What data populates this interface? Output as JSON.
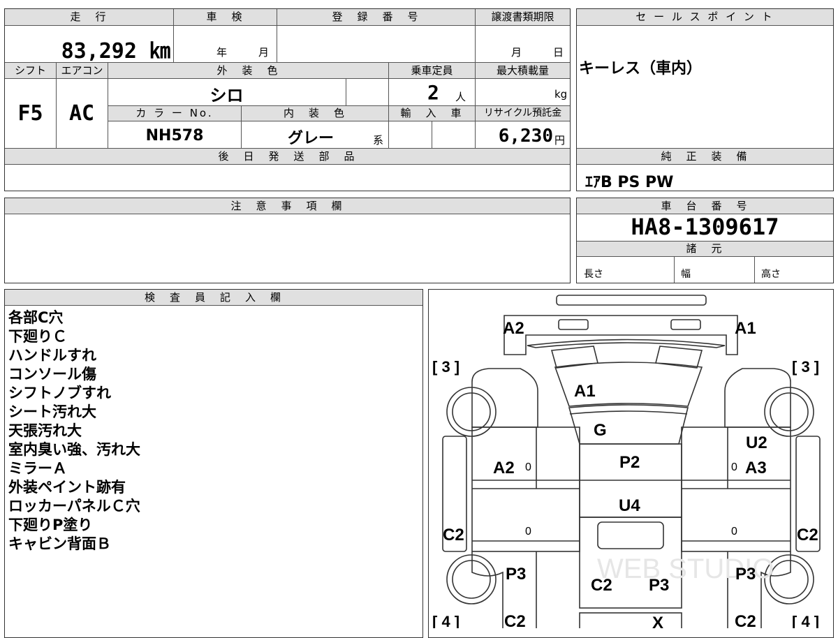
{
  "top_table": {
    "mileage_label": "走　行",
    "mileage_value": "83,292 ㎞",
    "inspection_label": "車　検",
    "inspection_year": "年",
    "inspection_month": "月",
    "registration_label": "登　録　番　号",
    "transfer_label": "譲渡書類期限",
    "transfer_month": "月",
    "transfer_day": "日",
    "shift_label": "シフト",
    "shift_value": "F5",
    "ac_label": "エアコン",
    "ac_value": "AC",
    "exterior_label": "外　装　色",
    "exterior_value": "シロ",
    "capacity_label": "乗車定員",
    "capacity_value": "2",
    "capacity_unit": "人",
    "maxload_label": "最大積載量",
    "maxload_unit": "kg",
    "color_no_label": "カ ラ ー No.",
    "color_no_value": "NH578",
    "interior_label": "内　装　色",
    "interior_value": "グレー",
    "interior_suffix": "系",
    "import_label": "輸　入　車",
    "recycle_label": "リサイクル預託金",
    "recycle_value": "6,230",
    "recycle_unit": "円",
    "later_parts_label": "後　日　発　送　部　品"
  },
  "sales_point": {
    "label": "セ ー ル ス ポ イ ン ト",
    "value": "キーレス（車内）"
  },
  "genuine_equipment": {
    "label": "純　正　装　備",
    "value": "ｴｱB PS PW"
  },
  "notes_section": {
    "label": "注　意　事　項　欄"
  },
  "chassis": {
    "label": "車　台　番　号",
    "value": "HA8-1309617",
    "specs_label": "諸　元",
    "length_label": "長さ",
    "width_label": "幅",
    "height_label": "高さ"
  },
  "inspector": {
    "label": "検　査　員　記　入　欄",
    "lines": [
      "各部C穴",
      "下廻りＣ",
      "ハンドルすれ",
      "コンソール傷",
      "シフトノブすれ",
      "シート汚れ大",
      "天張汚れ大",
      "室内臭い強、汚れ大",
      "ミラーＡ",
      "外装ペイント跡有",
      "ロッカーパネルＣ穴",
      "下廻りP塗り",
      "キャビン背面Ｂ"
    ]
  },
  "diagram": {
    "marks": {
      "front_a2": "A2",
      "front_a1": "A1",
      "hood_a1": "A1",
      "windshield_g": "G",
      "roof_p2": "P2",
      "bed_u4": "U4",
      "left_a2": "A2",
      "right_u2": "U2",
      "right_a3": "A3",
      "left_c2": "C2",
      "right_c2": "C2",
      "left_p3": "P3",
      "right_p3": "P3",
      "center_c2": "C2",
      "center_p3": "P3",
      "bottom_left_c2": "C2",
      "bottom_right_c2": "C2",
      "bottom_x": "X",
      "zero": "0",
      "tire_front": "[ 3 ]",
      "tire_rear": "[ 4 ]"
    },
    "watermark": "WEB STUDIO"
  }
}
